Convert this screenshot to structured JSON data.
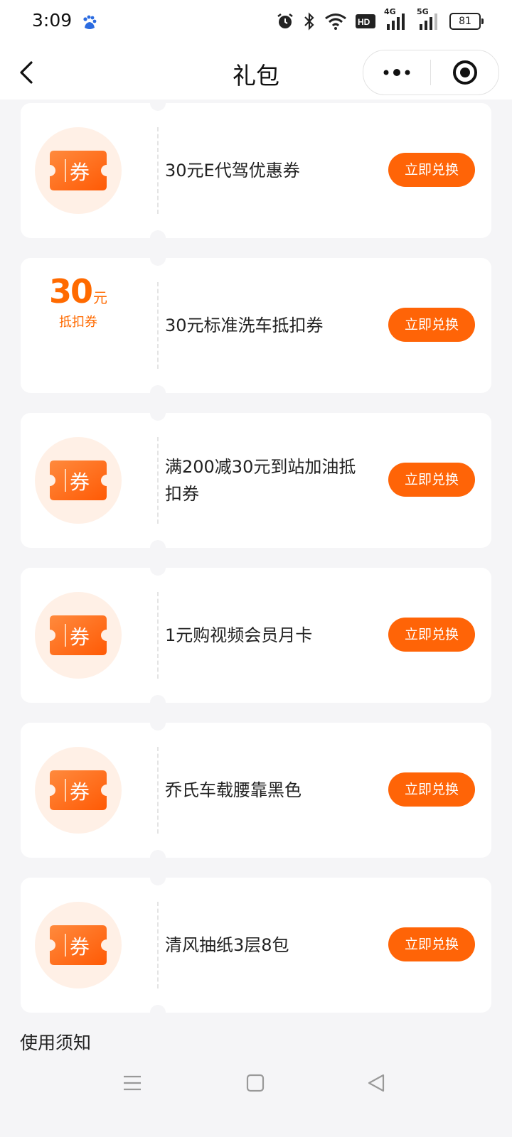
{
  "status_bar": {
    "time": "3:09",
    "icons": [
      "baidu-icon",
      "alarm-icon",
      "bluetooth-icon",
      "wifi-icon",
      "hd-icon",
      "signal-4g-icon",
      "signal-5g-icon"
    ],
    "hd_label": "HD",
    "net1": "4G",
    "net2": "5G",
    "battery": "81"
  },
  "nav": {
    "title": "礼包"
  },
  "coupons": [
    {
      "name": "30元E代驾优惠券",
      "button": "立即兑换",
      "icon_char": "券"
    },
    {
      "name": "30元标准洗车抵扣券",
      "button": "立即兑换",
      "value": "30",
      "unit": "元",
      "sub": "抵扣券"
    },
    {
      "name": "满200减30元到站加油抵扣券",
      "button": "立即兑换",
      "icon_char": "券"
    },
    {
      "name": "1元购视频会员月卡",
      "button": "立即兑换",
      "icon_char": "券"
    },
    {
      "name": "乔氏车载腰靠黑色",
      "button": "立即兑换",
      "icon_char": "券"
    },
    {
      "name": "清风抽纸3层8包",
      "button": "立即兑换",
      "icon_char": "券"
    }
  ],
  "notice": {
    "title": "使用须知"
  },
  "colors": {
    "accent": "#ff6407",
    "icon_bg": "#fff0e6",
    "page_bg": "#f5f5f7"
  }
}
